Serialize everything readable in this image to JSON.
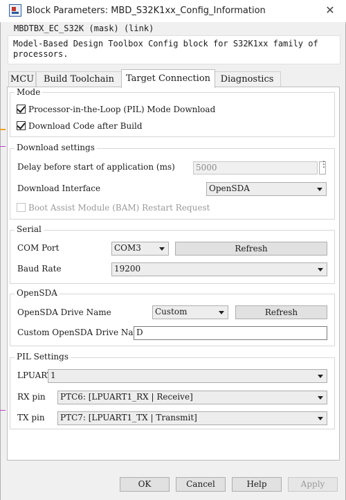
{
  "window": {
    "title": "Block Parameters: MBD_S32K1xx_Config_Information",
    "mask_name": "MBDTBX_EC_S32K (mask) (link)",
    "description": "Model-Based Design Toolbox Config block for S32K1xx family of processors."
  },
  "tabs": [
    {
      "label": "MCU",
      "active": false
    },
    {
      "label": "Build Toolchain",
      "active": false
    },
    {
      "label": "Target Connection",
      "active": true
    },
    {
      "label": "Diagnostics",
      "active": false
    }
  ],
  "mode": {
    "title": "Mode",
    "pil_label": "Processor-in-the-Loop (PIL) Mode Download",
    "pil_checked": true,
    "download_label": "Download Code after Build",
    "download_checked": true
  },
  "download_settings": {
    "title": "Download settings",
    "delay_label": "Delay before start of application (ms)",
    "delay_value": "5000",
    "more_button": "⋮",
    "interface_label": "Download Interface",
    "interface_value": "OpenSDA",
    "bam_label": "Boot Assist Module (BAM) Restart Request",
    "bam_checked": false
  },
  "serial": {
    "title": "Serial",
    "com_label": "COM Port",
    "com_value": "COM3",
    "refresh_label": "Refresh",
    "baud_label": "Baud Rate",
    "baud_value": "19200"
  },
  "opensda": {
    "title": "OpenSDA",
    "drive_label": "OpenSDA Drive Name",
    "drive_value": "Custom",
    "refresh_label": "Refresh",
    "custom_label": "Custom OpenSDA Drive Name",
    "custom_value": "D"
  },
  "pil_settings": {
    "title": "PIL Settings",
    "lpuart_label": "LPUART",
    "lpuart_value": "1",
    "rx_label": "RX pin",
    "rx_value": "PTC6: [LPUART1_RX | Receive]",
    "tx_label": "TX pin",
    "tx_value": "PTC7: [LPUART1_TX | Transmit]"
  },
  "footer": {
    "ok": "OK",
    "cancel": "Cancel",
    "help": "Help",
    "apply": "Apply"
  },
  "colors": {
    "accent_check": "#222222",
    "panel_bg": "#ffffff",
    "window_bg": "#f0f0f0"
  }
}
